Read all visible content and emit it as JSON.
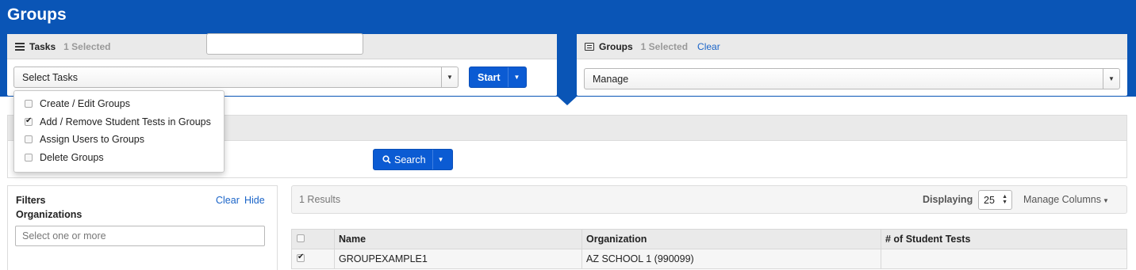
{
  "page": {
    "title": "Groups"
  },
  "tasks_panel": {
    "title": "Tasks",
    "selected": "1 Selected",
    "select_value": "Select Tasks",
    "start_label": "Start"
  },
  "task_menu": {
    "items": [
      {
        "label": "Create / Edit Groups",
        "checked": false
      },
      {
        "label": "Add / Remove Student Tests in Groups",
        "checked": true
      },
      {
        "label": "Assign Users to Groups",
        "checked": false
      },
      {
        "label": "Delete Groups",
        "checked": false
      }
    ]
  },
  "groups_panel": {
    "title": "Groups",
    "selected": "1 Selected",
    "clear_label": "Clear",
    "select_value": "Manage"
  },
  "search": {
    "button_label": "Search"
  },
  "filters": {
    "title": "Filters",
    "subtitle": "Organizations",
    "clear_label": "Clear",
    "hide_label": "Hide",
    "org_placeholder": "Select one or more"
  },
  "results": {
    "count": "1 Results",
    "displaying_label": "Displaying",
    "page_size": "25",
    "manage_columns": "Manage Columns"
  },
  "table": {
    "headers": [
      "Name",
      "Organization",
      "# of Student Tests"
    ],
    "rows": [
      {
        "checked": true,
        "name": "GROUPEXAMPLE1",
        "organization": "AZ SCHOOL 1 (990099)",
        "student_tests": ""
      }
    ]
  },
  "colors": {
    "brand": "#0a55b6",
    "button": "#0b5bd3",
    "link": "#1a64c8"
  }
}
